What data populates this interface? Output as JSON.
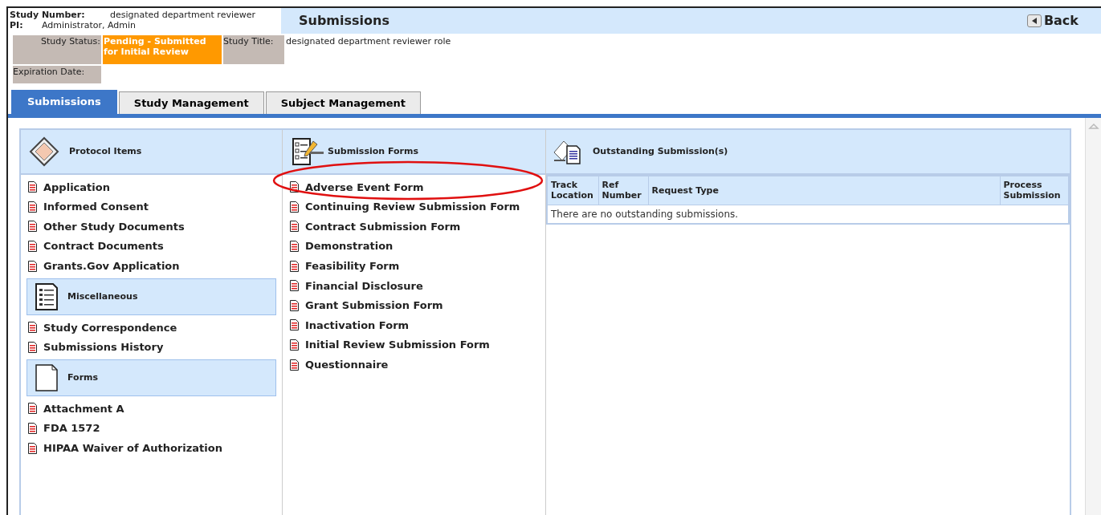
{
  "header": {
    "study_number_label": "Study Number:",
    "study_number": "designated department reviewer",
    "pi_label": "PI:",
    "pi": "Administrator, Admin",
    "page_title": "Submissions",
    "back_button": "Back"
  },
  "status": {
    "status_label": "Study Status:",
    "status_value": "Pending - Submitted for Initial Review",
    "title_label": "Study Title:",
    "title_value": "designated department reviewer role",
    "expiration_label": "Expiration Date:"
  },
  "tabs": [
    {
      "label": "Submissions",
      "selected": true
    },
    {
      "label": "Study Management",
      "selected": false
    },
    {
      "label": "Subject Management",
      "selected": false
    }
  ],
  "protocol_sections": [
    {
      "kind": "main",
      "title": "Protocol Items",
      "items": [
        "Application",
        "Informed Consent",
        "Other Study Documents",
        "Contract Documents",
        "Grants.Gov Application"
      ]
    },
    {
      "kind": "sub",
      "title": "Miscellaneous",
      "items": [
        "Study Correspondence",
        "Submissions History"
      ]
    },
    {
      "kind": "sub",
      "title": "Forms",
      "items": [
        "Attachment A",
        "FDA 1572",
        "HIPAA Waiver of Authorization"
      ]
    }
  ],
  "submission_forms": {
    "title": "Submission Forms",
    "items": [
      "Adverse Event Form",
      "Continuing Review Submission Form",
      "Contract Submission Form",
      "Demonstration",
      "Feasibility Form",
      "Financial Disclosure",
      "Grant Submission Form",
      "Inactivation Form",
      "Initial Review Submission Form",
      "Questionnaire"
    ]
  },
  "outstanding": {
    "title": "Outstanding Submission(s)",
    "columns": [
      "Track Location",
      "Ref Number",
      "Request Type",
      "Process Submission"
    ],
    "empty_message": "There are no outstanding submissions."
  }
}
